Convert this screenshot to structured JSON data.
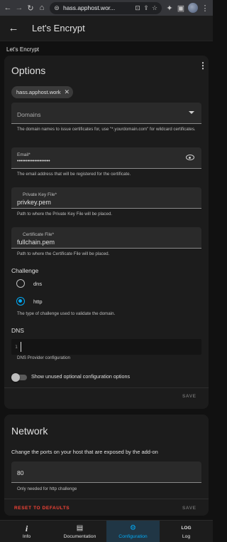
{
  "browser": {
    "url": "hass.apphost.wor...",
    "icons": [
      "back-icon",
      "forward-icon",
      "reload-icon",
      "home-icon",
      "security-icon",
      "install-app-icon",
      "share-icon",
      "bookmark-star-icon",
      "extensions-icon",
      "side-panel-icon",
      "profile-avatar",
      "more-icon"
    ]
  },
  "header": {
    "title": "Let's Encrypt"
  },
  "page_heading": "Let's Encrypt",
  "options_card": {
    "title": "Options",
    "domains": {
      "chip_value": "hass.apphost.work",
      "placeholder": "Domains",
      "helper": "The domain names to issue certificates for, use \"*.yourdomain.com\" for wildcard certificates."
    },
    "email": {
      "label": "Email*",
      "value": "•••••••••••••••••••",
      "helper": "The email address that will be registered for the certificate."
    },
    "private_key": {
      "label": "Private Key File*",
      "value": "privkey.pem",
      "helper": "Path to where the Private Key File will be placed."
    },
    "certificate": {
      "label": "Certificate File*",
      "value": "fullchain.pem",
      "helper": "Path to where the Certificate File will be placed."
    },
    "challenge": {
      "label": "Challenge",
      "options": [
        "dns",
        "http"
      ],
      "selected": "http",
      "helper": "The type of challenge used to validate the domain."
    },
    "dns": {
      "label": "DNS",
      "line_number": "1",
      "helper": "DNS Provider configuration"
    },
    "toggle_label": "Show unused optional configuration options",
    "save_label": "SAVE"
  },
  "network_card": {
    "title": "Network",
    "description": "Change the ports on your host that are exposed by the add-on",
    "port_value": "80",
    "helper": "Only needed for http challenge",
    "reset_label": "RESET TO DEFAULTS",
    "save_label": "SAVE"
  },
  "bottom_nav": {
    "items": [
      {
        "label": "Info",
        "icon": "i"
      },
      {
        "label": "Documentation",
        "icon": "▤"
      },
      {
        "label": "Configuration",
        "icon": "⚙"
      },
      {
        "label": "Log",
        "icon": "LOG"
      }
    ],
    "active": "Configuration"
  },
  "colors": {
    "accent": "#03a9f4",
    "reset": "#f44336",
    "background": "#111111",
    "card": "#1c1c1c"
  }
}
